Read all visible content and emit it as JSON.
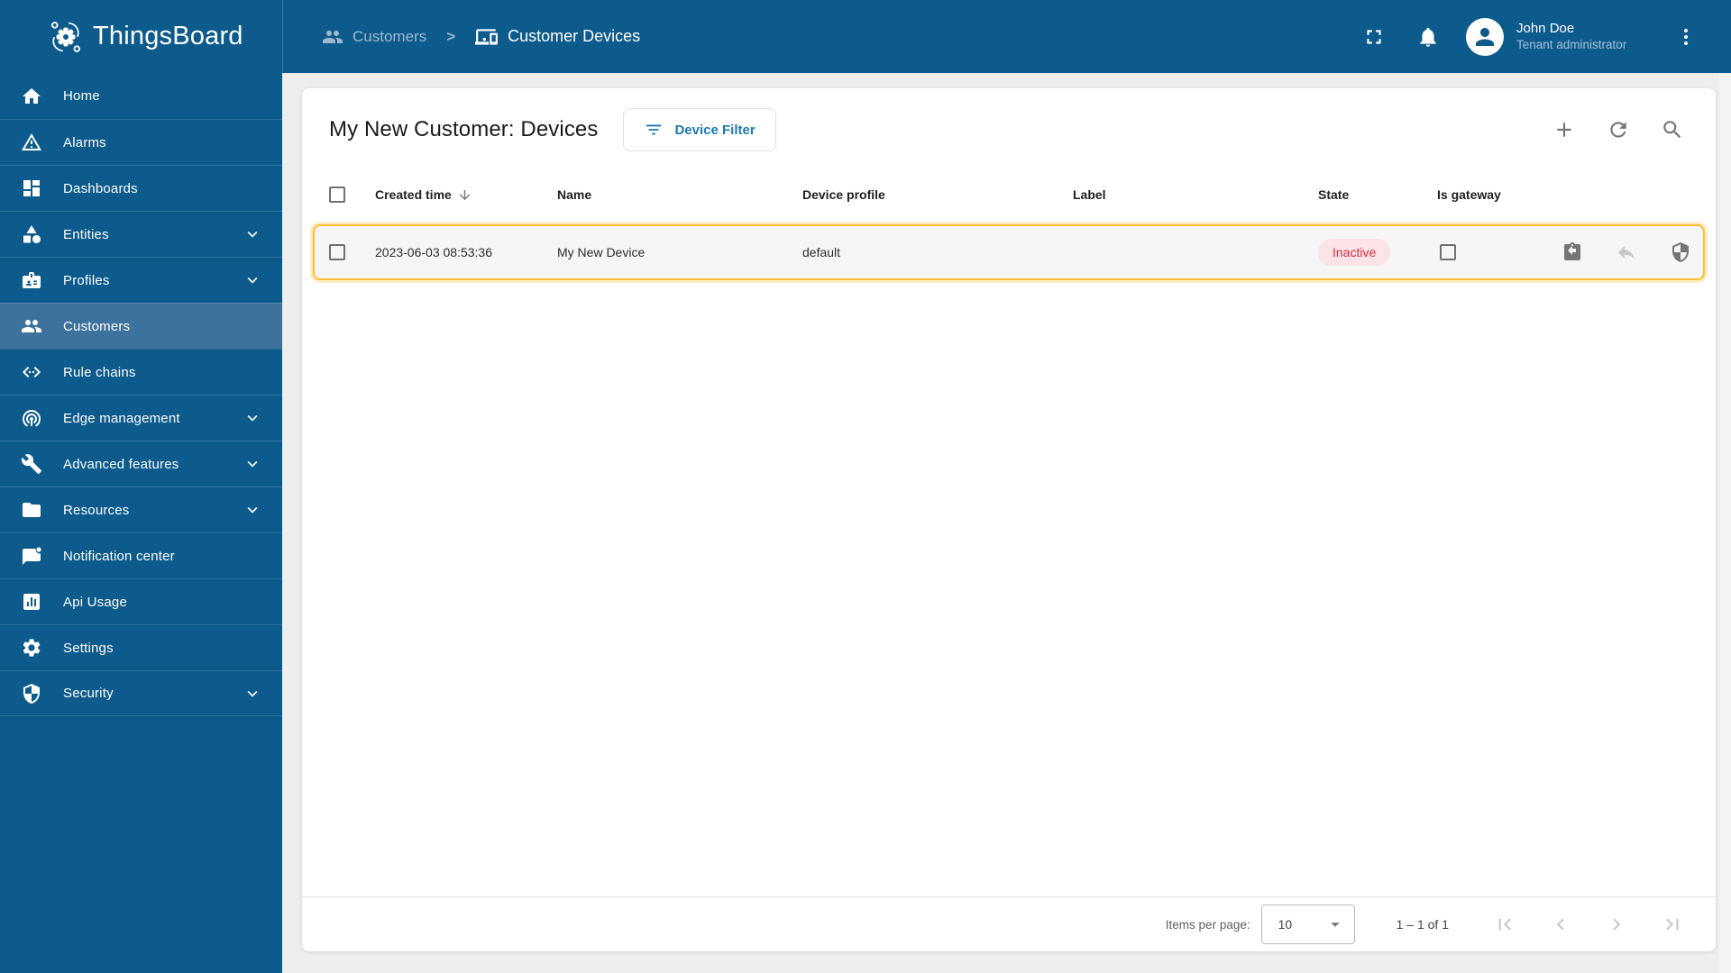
{
  "colors": {
    "primary": "#0d5a8c",
    "sidebar-active": "#3d729c",
    "page-bg": "#eeeeee",
    "accent-amber": "#ffbe2e",
    "badge-inactive-text": "#d12f3d",
    "badge-inactive-bg": "#fbe3e7",
    "link-blue": "#1b79ae",
    "icon-gray": "#757575",
    "icon-disabled": "#c9c9c9",
    "breadcrumb-muted": "#9fb9cd"
  },
  "header": {
    "app_name": "ThingsBoard",
    "breadcrumb": {
      "parent": "Customers",
      "separator": ">",
      "current": "Customer Devices"
    },
    "icons": [
      "fullscreen-icon",
      "bell-icon",
      "kebab-menu-icon"
    ],
    "user": {
      "name": "John Doe",
      "role": "Tenant administrator"
    }
  },
  "sidebar": {
    "items": [
      {
        "label": "Home",
        "icon": "home-icon",
        "expandable": false,
        "active": false
      },
      {
        "label": "Alarms",
        "icon": "warning-triangle-icon",
        "expandable": false,
        "active": false
      },
      {
        "label": "Dashboards",
        "icon": "dashboard-grid-icon",
        "expandable": false,
        "active": false
      },
      {
        "label": "Entities",
        "icon": "shapes-icon",
        "expandable": true,
        "active": false
      },
      {
        "label": "Profiles",
        "icon": "badge-icon",
        "expandable": true,
        "active": false
      },
      {
        "label": "Customers",
        "icon": "people-icon",
        "expandable": false,
        "active": true
      },
      {
        "label": "Rule chains",
        "icon": "code-dots-icon",
        "expandable": false,
        "active": false
      },
      {
        "label": "Edge management",
        "icon": "antenna-icon",
        "expandable": true,
        "active": false
      },
      {
        "label": "Advanced features",
        "icon": "wrench-icon",
        "expandable": true,
        "active": false
      },
      {
        "label": "Resources",
        "icon": "folder-icon",
        "expandable": true,
        "active": false
      },
      {
        "label": "Notification center",
        "icon": "message-dot-icon",
        "expandable": false,
        "active": false
      },
      {
        "label": "Api Usage",
        "icon": "bar-chart-icon",
        "expandable": false,
        "active": false
      },
      {
        "label": "Settings",
        "icon": "gear-icon",
        "expandable": false,
        "active": false
      },
      {
        "label": "Security",
        "icon": "shield-icon",
        "expandable": true,
        "active": false
      }
    ]
  },
  "main": {
    "title": "My New Customer: Devices",
    "filter_button": "Device Filter",
    "toolbar_icons": [
      "add-icon",
      "refresh-icon",
      "search-icon"
    ],
    "table": {
      "columns": [
        "",
        "Created time",
        "Name",
        "Device profile",
        "Label",
        "State",
        "Is gateway",
        ""
      ],
      "sorted_column": "Created time",
      "rows": [
        {
          "created_time": "2023-06-03 08:53:36",
          "name": "My New Device",
          "device_profile": "default",
          "label": "",
          "state": "Inactive",
          "is_gateway": false,
          "action_icons": [
            "clipboard-return-icon",
            "reply-icon",
            "shield-icon"
          ]
        }
      ]
    },
    "pagination": {
      "items_per_page_label": "Items per page:",
      "items_per_page": "10",
      "range": "1 – 1 of 1",
      "pager_icons": [
        "first-page-icon",
        "prev-page-icon",
        "next-page-icon",
        "last-page-icon"
      ]
    }
  }
}
